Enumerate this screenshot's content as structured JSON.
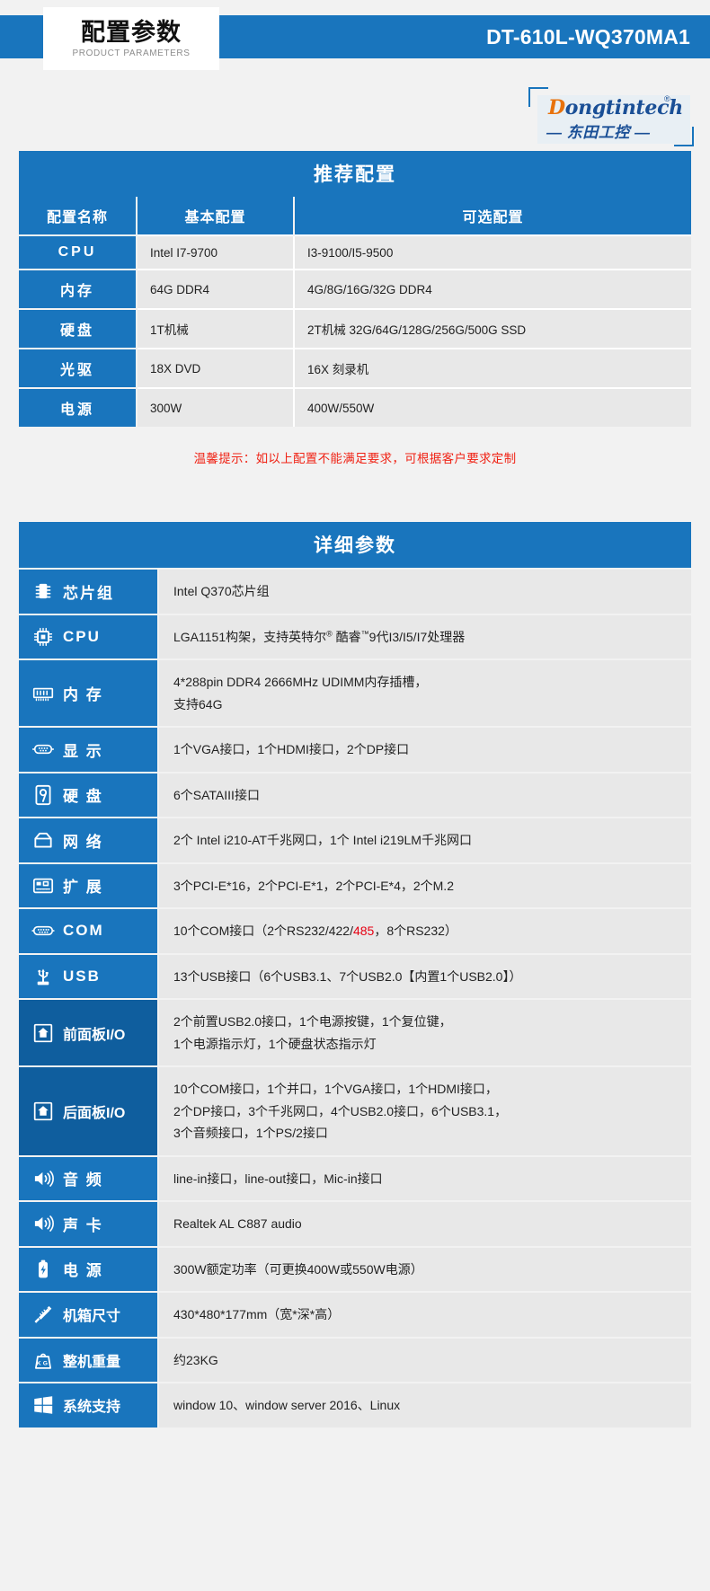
{
  "header": {
    "title_cn": "配置参数",
    "title_en": "PRODUCT PARAMETERS",
    "model": "DT-610L-WQ370MA1"
  },
  "logo": {
    "brand_initial": "D",
    "brand_rest": "ongtintech",
    "registered": "®",
    "brand_cn": "— 东田工控 —"
  },
  "recommended": {
    "section_title": "推荐配置",
    "columns": [
      "配置名称",
      "基本配置",
      "可选配置"
    ],
    "rows": [
      {
        "name": "CPU",
        "basic": "Intel I7-9700",
        "optional": "I3-9100/I5-9500"
      },
      {
        "name": "内存",
        "basic": "64G DDR4",
        "optional": "4G/8G/16G/32G DDR4"
      },
      {
        "name": "硬盘",
        "basic": "1T机械",
        "optional": "2T机械 32G/64G/128G/256G/500G SSD"
      },
      {
        "name": "光驱",
        "basic": "18X DVD",
        "optional": "16X 刻录机"
      },
      {
        "name": "电源",
        "basic": "300W",
        "optional": "400W/550W"
      }
    ],
    "tip": "温馨提示：如以上配置不能满足要求，可根据客户要求定制"
  },
  "detail": {
    "section_title": "详细参数",
    "rows": [
      {
        "icon": "chip-icon",
        "label": "芯片组",
        "value_lines": [
          "Intel Q370芯片组"
        ]
      },
      {
        "icon": "cpu-icon",
        "label": "CPU",
        "value_lines": [
          "LGA1151构架，支持英特尔® 酷睿™9代I3/I5/I7处理器"
        ]
      },
      {
        "icon": "memory-icon",
        "label": "内 存",
        "value_lines": [
          "4*288pin DDR4 2666MHz UDIMM内存插槽，",
          "支持64G"
        ]
      },
      {
        "icon": "display-port-icon",
        "label": "显 示",
        "value_lines": [
          "1个VGA接口，1个HDMI接口，2个DP接口"
        ]
      },
      {
        "icon": "harddisk-icon",
        "label": "硬 盘",
        "value_lines": [
          "6个SATAIII接口"
        ]
      },
      {
        "icon": "network-icon",
        "label": "网 络",
        "value_lines": [
          "2个 Intel i210-AT千兆网口，1个 Intel i219LM千兆网口"
        ]
      },
      {
        "icon": "expansion-icon",
        "label": "扩 展",
        "value_lines": [
          "3个PCI-E*16，2个PCI-E*1，2个PCI-E*4，2个M.2"
        ]
      },
      {
        "icon": "com-port-icon",
        "label": "COM",
        "value_lines": [
          "10个COM接口（2个RS232/422/485，8个RS232）"
        ]
      },
      {
        "icon": "usb-icon",
        "label": "USB",
        "value_lines": [
          "13个USB接口（6个USB3.1、7个USB2.0【内置1个USB2.0】）"
        ]
      },
      {
        "icon": "front-panel-icon",
        "label": "前面板I/O",
        "value_lines": [
          "2个前置USB2.0接口，1个电源按键，1个复位键，",
          "1个电源指示灯，1个硬盘状态指示灯"
        ]
      },
      {
        "icon": "rear-panel-icon",
        "label": "后面板I/O",
        "value_lines": [
          "10个COM接口，1个并口，1个VGA接口，1个HDMI接口，",
          "2个DP接口，3个千兆网口，4个USB2.0接口，6个USB3.1，",
          "3个音频接口，1个PS/2接口"
        ]
      },
      {
        "icon": "audio-icon",
        "label": "音 频",
        "value_lines": [
          "line-in接口，line-out接口，Mic-in接口"
        ]
      },
      {
        "icon": "soundcard-icon",
        "label": "声 卡",
        "value_lines": [
          "Realtek AL C887 audio"
        ]
      },
      {
        "icon": "power-icon",
        "label": "电 源",
        "value_lines": [
          "300W额定功率（可更换400W或550W电源）"
        ]
      },
      {
        "icon": "dimension-icon",
        "label": "机箱尺寸",
        "value_lines": [
          "430*480*177mm（宽*深*高）"
        ]
      },
      {
        "icon": "weight-icon",
        "label": "整机重量",
        "value_lines": [
          "约23KG"
        ]
      },
      {
        "icon": "windows-icon",
        "label": "系统支持",
        "value_lines": [
          "window 10、window server 2016、Linux"
        ]
      }
    ],
    "com_highlight": "485"
  },
  "colors": {
    "brand_blue": "#1975bd",
    "deep_blue": "#0f5e9e",
    "value_bg": "#e8e8e8",
    "page_bg": "#f2f2f2",
    "tip_red": "#f02214",
    "highlight_red": "#e60012"
  }
}
